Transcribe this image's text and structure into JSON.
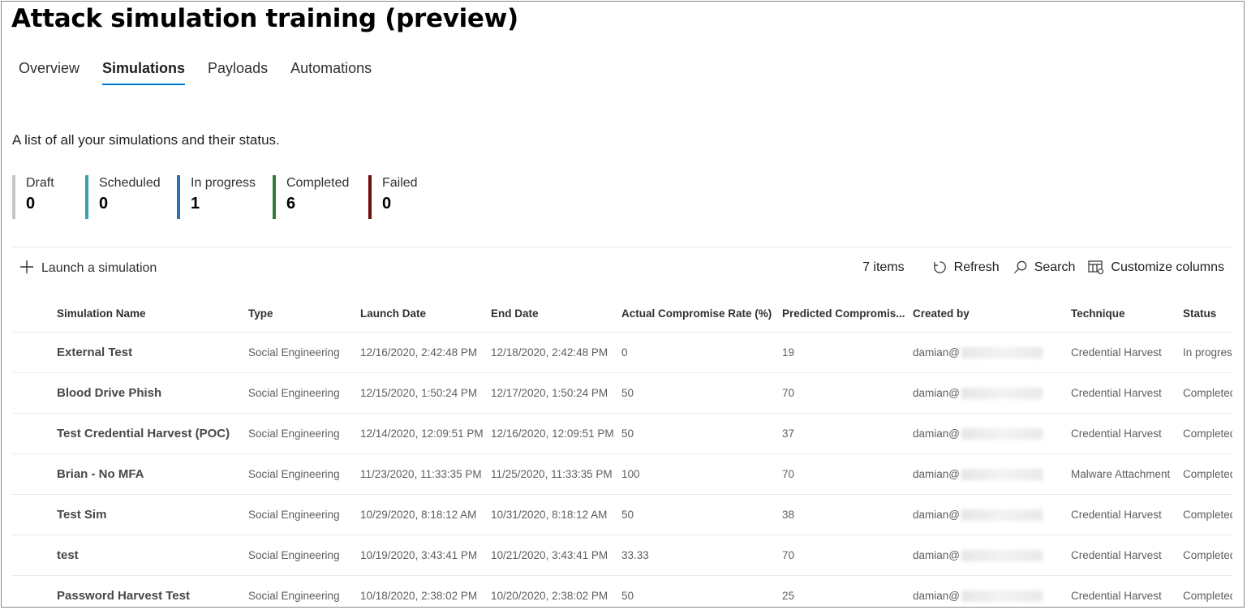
{
  "page": {
    "title": "Attack simulation training (preview)",
    "subtitle": "A list of all your simulations and their status."
  },
  "tabs": [
    {
      "label": "Overview",
      "active": false
    },
    {
      "label": "Simulations",
      "active": true
    },
    {
      "label": "Payloads",
      "active": false
    },
    {
      "label": "Automations",
      "active": false
    }
  ],
  "stats": [
    {
      "label": "Draft",
      "value": "0",
      "color": "#c8c6c4"
    },
    {
      "label": "Scheduled",
      "value": "0",
      "color": "#3aa0b0"
    },
    {
      "label": "In progress",
      "value": "1",
      "color": "#2f6fb6"
    },
    {
      "label": "Completed",
      "value": "6",
      "color": "#2e7d32"
    },
    {
      "label": "Failed",
      "value": "0",
      "color": "#6b0f0f"
    }
  ],
  "commandbar": {
    "launch_label": "Launch a simulation",
    "items_count": "7 items",
    "refresh_label": "Refresh",
    "search_label": "Search",
    "customize_label": "Customize columns"
  },
  "table": {
    "columns": [
      "Simulation Name",
      "Type",
      "Launch Date",
      "End Date",
      "Actual Compromise Rate (%)",
      "Predicted Compromis...",
      "Created by",
      "Technique",
      "Status"
    ],
    "rows": [
      {
        "name": "External Test",
        "type": "Social Engineering",
        "launch": "12/16/2020, 2:42:48 PM",
        "end": "12/18/2020, 2:42:48 PM",
        "actual": "0",
        "predicted": "19",
        "created": "damian@",
        "technique": "Credential Harvest",
        "status": "In progress"
      },
      {
        "name": "Blood Drive Phish",
        "type": "Social Engineering",
        "launch": "12/15/2020, 1:50:24 PM",
        "end": "12/17/2020, 1:50:24 PM",
        "actual": "50",
        "predicted": "70",
        "created": "damian@",
        "technique": "Credential Harvest",
        "status": "Completed"
      },
      {
        "name": "Test Credential Harvest (POC)",
        "type": "Social Engineering",
        "launch": "12/14/2020, 12:09:51 PM",
        "end": "12/16/2020, 12:09:51 PM",
        "actual": "50",
        "predicted": "37",
        "created": "damian@",
        "technique": "Credential Harvest",
        "status": "Completed"
      },
      {
        "name": "Brian - No MFA",
        "type": "Social Engineering",
        "launch": "11/23/2020, 11:33:35 PM",
        "end": "11/25/2020, 11:33:35 PM",
        "actual": "100",
        "predicted": "70",
        "created": "damian@",
        "technique": "Malware Attachment",
        "status": "Completed"
      },
      {
        "name": "Test Sim",
        "type": "Social Engineering",
        "launch": "10/29/2020, 8:18:12 AM",
        "end": "10/31/2020, 8:18:12 AM",
        "actual": "50",
        "predicted": "38",
        "created": "damian@",
        "technique": "Credential Harvest",
        "status": "Completed"
      },
      {
        "name": "test",
        "type": "Social Engineering",
        "launch": "10/19/2020, 3:43:41 PM",
        "end": "10/21/2020, 3:43:41 PM",
        "actual": "33.33",
        "predicted": "70",
        "created": "damian@",
        "technique": "Credential Harvest",
        "status": "Completed"
      },
      {
        "name": "Password Harvest Test",
        "type": "Social Engineering",
        "launch": "10/18/2020, 2:38:02 PM",
        "end": "10/20/2020, 2:38:02 PM",
        "actual": "50",
        "predicted": "25",
        "created": "damian@",
        "technique": "Credential Harvest",
        "status": "Completed"
      }
    ]
  },
  "icons": {
    "launch": "plus-icon",
    "refresh": "refresh-icon",
    "search": "search-icon",
    "customize": "customize-columns-icon"
  }
}
